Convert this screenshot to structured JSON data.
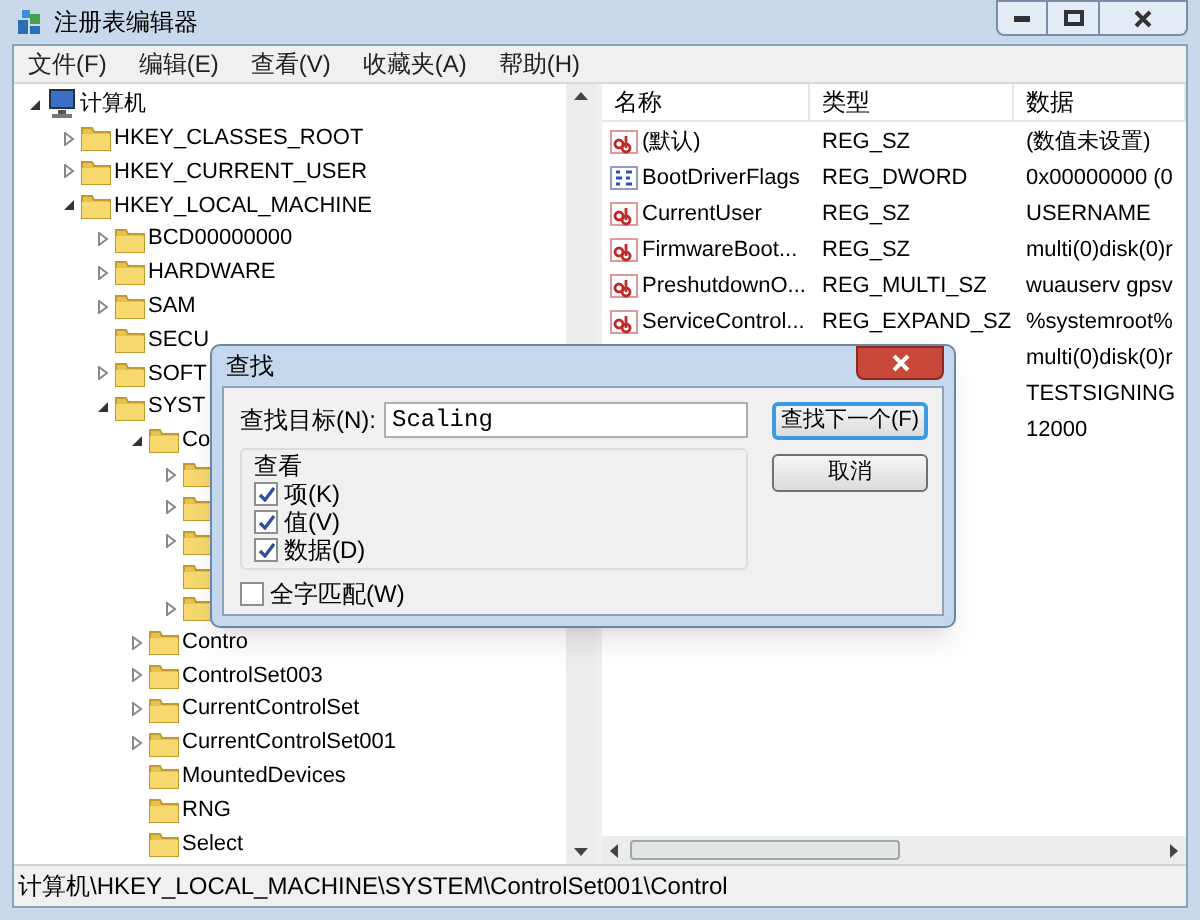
{
  "window": {
    "title": "注册表编辑器"
  },
  "menu": [
    "文件(F)",
    "编辑(E)",
    "查看(V)",
    "收藏夹(A)",
    "帮助(H)"
  ],
  "tree": [
    {
      "label": "计算机",
      "kind": "computer",
      "expandable": true,
      "expanded": true,
      "children": [
        {
          "label": "HKEY_CLASSES_ROOT",
          "expandable": true,
          "expanded": false
        },
        {
          "label": "HKEY_CURRENT_USER",
          "expandable": true,
          "expanded": false
        },
        {
          "label": "HKEY_LOCAL_MACHINE",
          "expandable": true,
          "expanded": true,
          "children": [
            {
              "label": "BCD00000000",
              "expandable": true,
              "expanded": false
            },
            {
              "label": "HARDWARE",
              "expandable": true,
              "expanded": false
            },
            {
              "label": "SAM",
              "expandable": true,
              "expanded": false
            },
            {
              "label": "SECU",
              "expandable": false,
              "expanded": false
            },
            {
              "label": "SOFT",
              "expandable": true,
              "expanded": false
            },
            {
              "label": "SYST",
              "expandable": true,
              "expanded": true,
              "children": [
                {
                  "label": "Co",
                  "expandable": true,
                  "expanded": true,
                  "children": [
                    {
                      "expandable": true,
                      "expanded": false
                    },
                    {
                      "expandable": true,
                      "expanded": false
                    },
                    {
                      "expandable": true,
                      "expanded": false
                    },
                    {
                      "expandable": false,
                      "expanded": false
                    },
                    {
                      "expandable": true,
                      "expanded": false
                    }
                  ]
                },
                {
                  "label": "Contro",
                  "expandable": true,
                  "expanded": false
                },
                {
                  "label": "ControlSet003",
                  "expandable": true,
                  "expanded": false
                },
                {
                  "label": "CurrentControlSet",
                  "expandable": true,
                  "expanded": false
                },
                {
                  "label": "CurrentControlSet001",
                  "expandable": true,
                  "expanded": false
                },
                {
                  "label": "MountedDevices",
                  "expandable": false,
                  "expanded": false
                },
                {
                  "label": "RNG",
                  "expandable": false,
                  "expanded": false
                },
                {
                  "label": "Select",
                  "expandable": false,
                  "expanded": false
                }
              ]
            }
          ]
        }
      ]
    }
  ],
  "table": {
    "columns": [
      "名称",
      "类型",
      "数据"
    ],
    "rows": [
      {
        "kind": "string",
        "name": "(默认)",
        "type": "REG_SZ",
        "data": "(数值未设置)"
      },
      {
        "kind": "binary",
        "name": "BootDriverFlags",
        "type": "REG_DWORD",
        "data": "0x00000000 (0"
      },
      {
        "kind": "string",
        "name": "CurrentUser",
        "type": "REG_SZ",
        "data": "USERNAME"
      },
      {
        "kind": "string",
        "name": "FirmwareBoot...",
        "type": "REG_SZ",
        "data": "multi(0)disk(0)r"
      },
      {
        "kind": "string",
        "name": "PreshutdownO...",
        "type": "REG_MULTI_SZ",
        "data": "wuauserv gpsv"
      },
      {
        "kind": "string",
        "name": "ServiceControl...",
        "type": "REG_EXPAND_SZ",
        "data": "%systemroot%"
      },
      {
        "kind": "hidden",
        "data": "multi(0)disk(0)r"
      },
      {
        "kind": "hidden",
        "data": "TESTSIGNING"
      },
      {
        "kind": "hidden",
        "data": "12000"
      }
    ]
  },
  "status_bar": "计算机\\HKEY_LOCAL_MACHINE\\SYSTEM\\ControlSet001\\Control",
  "dialog": {
    "title": "查找",
    "find_label": "查找目标(N):",
    "find_value": "Scaling",
    "group_label": "查看",
    "options": [
      {
        "label": "项(K)",
        "checked": true
      },
      {
        "label": "值(V)",
        "checked": true
      },
      {
        "label": "数据(D)",
        "checked": true
      }
    ],
    "whole_word": {
      "label": "全字匹配(W)",
      "checked": false
    },
    "buttons": [
      "查找下一个(F)",
      "取消"
    ]
  }
}
